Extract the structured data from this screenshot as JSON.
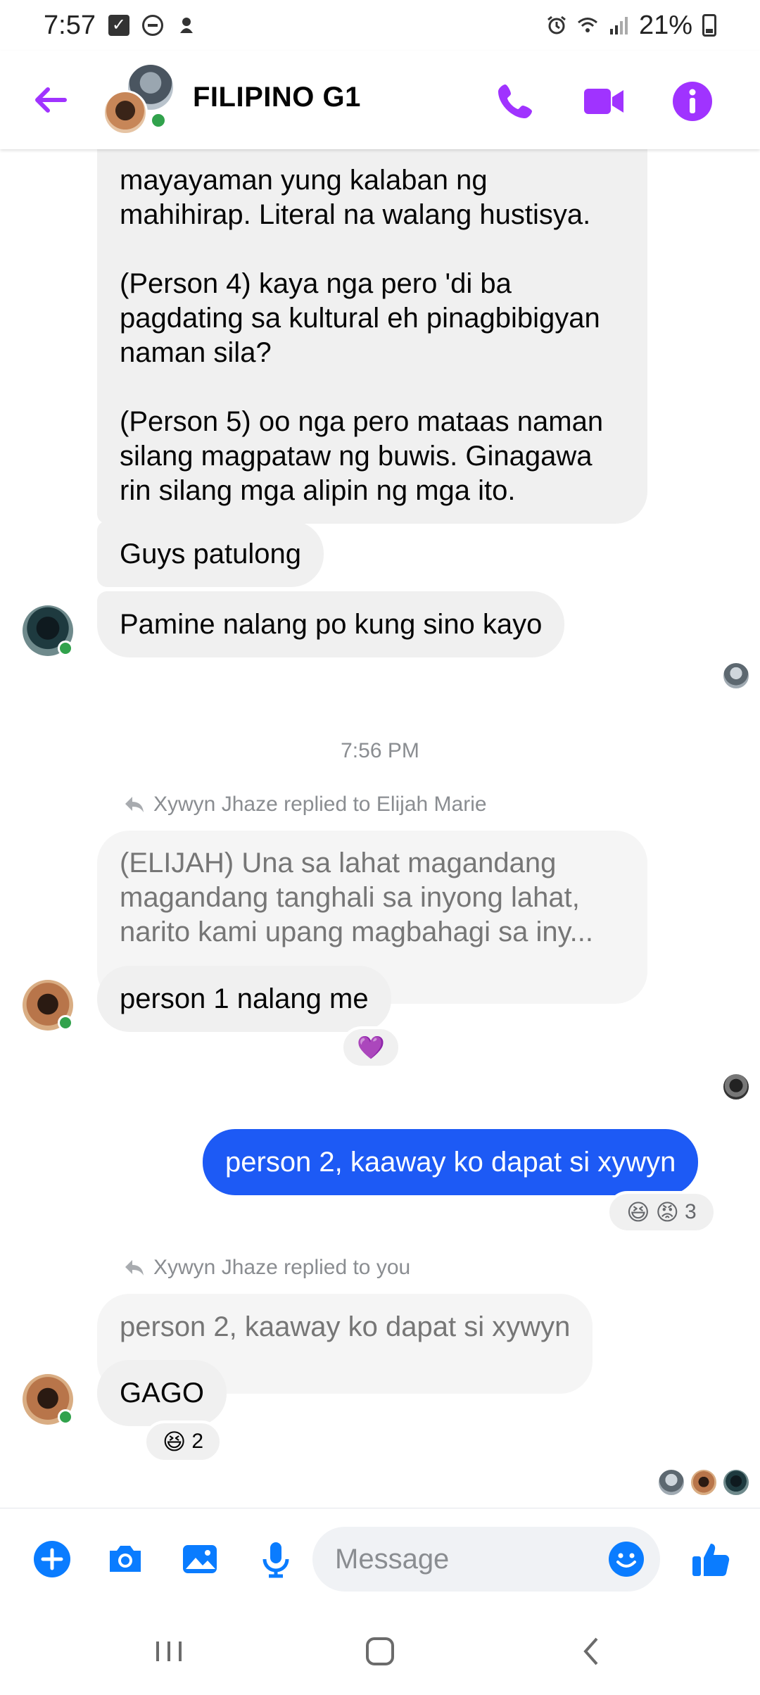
{
  "status_bar": {
    "time": "7:57",
    "battery": "21%"
  },
  "header": {
    "title": "FILIPINO G1"
  },
  "messages": {
    "big_text_lines": [
      "mayayaman yung kalaban ng",
      "mahihirap. Literal na walang hustisya.",
      "",
      "(Person 4) kaya nga pero 'di ba",
      "pagdating sa kultural eh pinagbibigyan",
      "naman sila?",
      "",
      "(Person 5) oo nga pero mataas naman",
      "silang magpataw ng buwis. Ginagawa",
      "rin silang mga alipin ng mga ito."
    ],
    "guys": "Guys patulong",
    "pamine": "Pamine nalang po kung sino kayo",
    "timestamp": "7:56 PM",
    "reply1_label": "Xywyn Jhaze replied to Elijah Marie",
    "reply1_quote": [
      "(ELIJAH)  Una sa lahat magandang",
      "magandang tanghali sa inyong lahat,",
      "narito kami upang magbahagi sa iny..."
    ],
    "reply1_text": "person 1 nalang me",
    "reply1_reaction": "💜",
    "mine_text": "person 2, kaaway ko dapat si xywyn",
    "mine_reaction_count": "3",
    "reply2_label": "Xywyn Jhaze replied to you",
    "reply2_quote": "person 2, kaaway ko dapat si xywyn",
    "reply2_text": "GAGO",
    "reply2_reaction_count": "2"
  },
  "composer": {
    "placeholder": "Message"
  },
  "colors": {
    "accent_purple": "#a033ff",
    "my_bubble": "#1d5af5",
    "composer_blue": "#0a7cff",
    "online": "#31a24c"
  }
}
